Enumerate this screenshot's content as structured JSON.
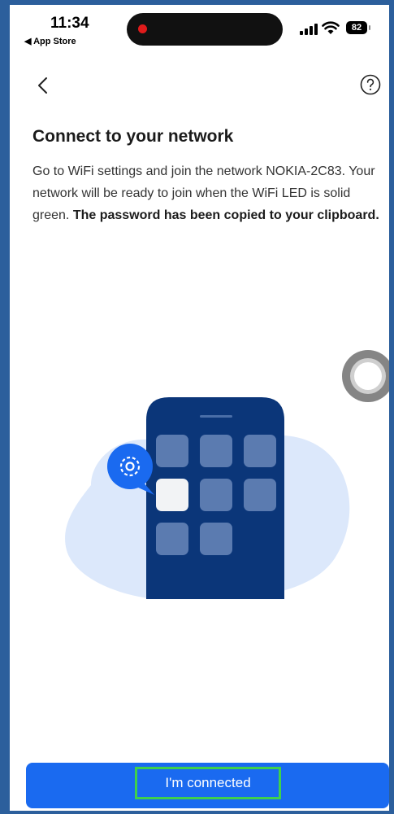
{
  "status_bar": {
    "time": "11:34",
    "back_app": "◀ App Store",
    "battery": "82",
    "icons": [
      "signal-icon",
      "wifi-icon",
      "battery-icon"
    ]
  },
  "nav": {
    "back_icon": "chevron-left-icon",
    "help_icon": "question-circle-icon"
  },
  "content": {
    "heading": "Connect to your network",
    "desc_part1": "Go to WiFi settings and join the network NOKIA-2C83. Your network will be ready to join when the WiFi LED is solid green. ",
    "desc_part2": "The password has been copied to your clipboard."
  },
  "illustration": {
    "icon": "gear-icon",
    "colors": {
      "phone": "#0b3679",
      "blob": "#dce8fb",
      "accent": "#1a6af0",
      "tile": "#5b7bb0"
    }
  },
  "button": {
    "label": "I'm connected",
    "color": "#1a6af0",
    "highlight": "#3fd14b"
  }
}
